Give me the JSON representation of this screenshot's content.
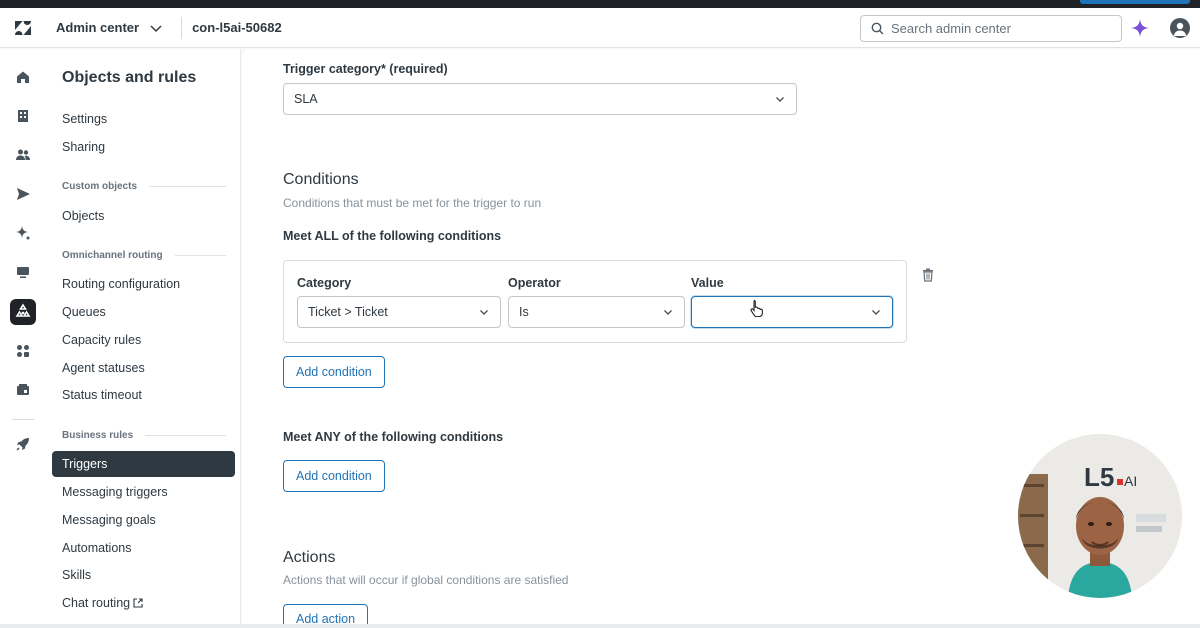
{
  "header": {
    "product_label": "Admin center",
    "account_label": "con-l5ai-50682",
    "search_placeholder": "Search admin center"
  },
  "subnav": {
    "title": "Objects and rules",
    "items_top": [
      "Settings",
      "Sharing"
    ],
    "section_custom_objects": "Custom objects",
    "item_objects": "Objects",
    "section_omnichannel": "Omnichannel routing",
    "omnichannel_items": [
      "Routing configuration",
      "Queues",
      "Capacity rules",
      "Agent statuses",
      "Status timeout"
    ],
    "section_business_rules": "Business rules",
    "active_item": "Triggers",
    "business_items": [
      "Messaging triggers",
      "Messaging goals",
      "Automations",
      "Skills",
      "Chat routing"
    ]
  },
  "form": {
    "trigger_category_label": "Trigger category* (required)",
    "trigger_category_value": "SLA",
    "conditions_title": "Conditions",
    "conditions_subtitle": "Conditions that must be met for the trigger to run",
    "meet_all_label": "Meet ALL of the following conditions",
    "col_category": "Category",
    "col_operator": "Operator",
    "col_value": "Value",
    "category_value": "Ticket > Ticket",
    "operator_value": "Is",
    "value_value": "",
    "add_condition_label": "Add condition",
    "meet_any_label": "Meet ANY of the following conditions",
    "add_condition_any_label": "Add condition",
    "actions_title": "Actions",
    "actions_subtitle": "Actions that will occur if global conditions are satisfied",
    "add_action_label": "Add action"
  },
  "webcam": {
    "logo_text": "L5.AI"
  },
  "icons": {
    "rail": [
      "home-icon",
      "building-icon",
      "people-icon",
      "send-icon",
      "sparkle-icon",
      "monitor-icon",
      "objects-rules-icon",
      "apps-icon",
      "workspace-icon",
      "rocket-icon"
    ]
  },
  "colors": {
    "accent": "#1f73b7",
    "active_nav": "#2f3941",
    "ai_sparkle": "#7b4fd6"
  }
}
